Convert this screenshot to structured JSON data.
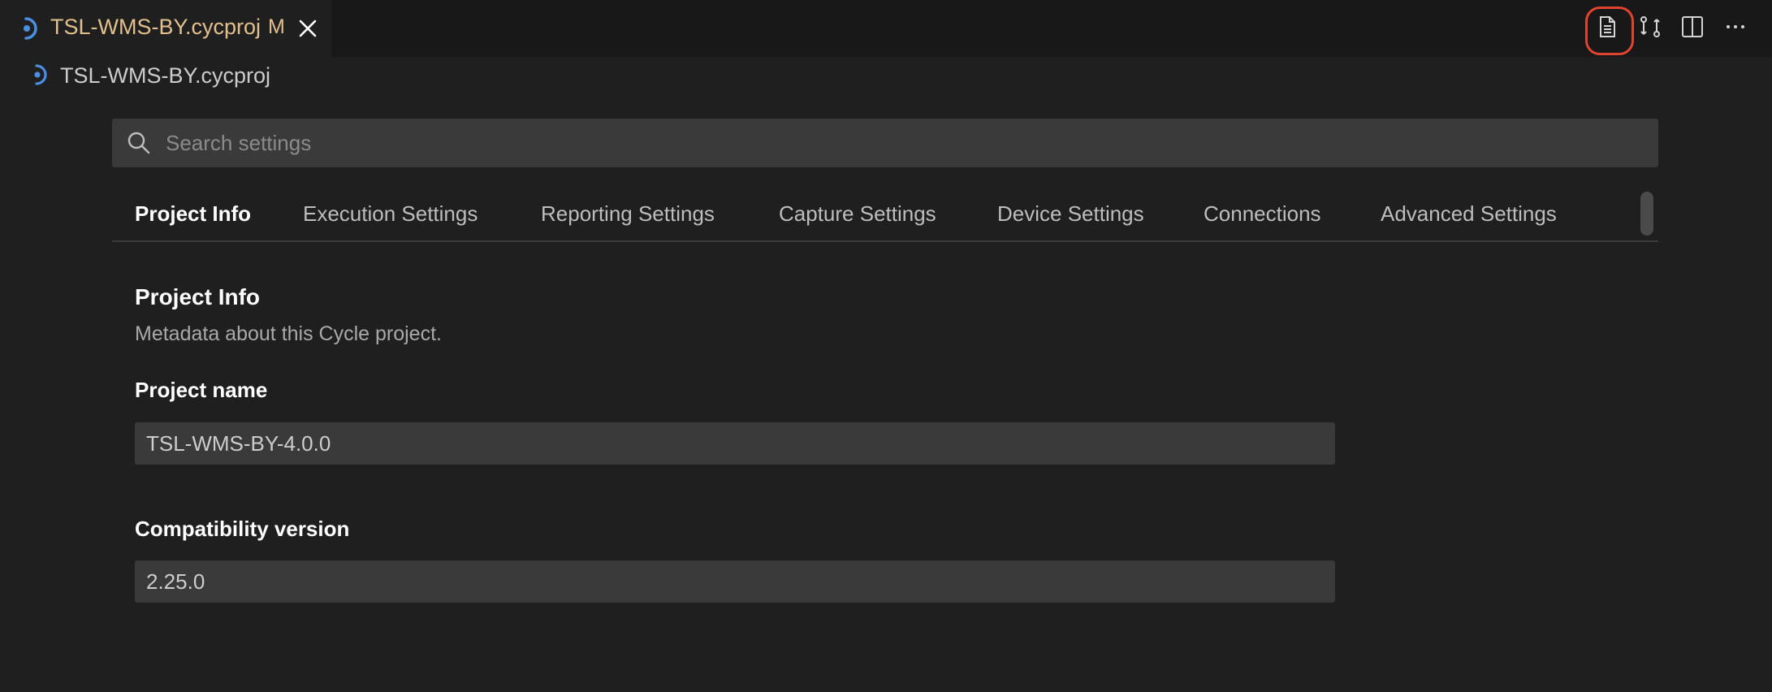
{
  "editor_tab": {
    "filename": "TSL-WMS-BY.cycproj",
    "modified_badge": "M",
    "accent_color": "#e2c08d",
    "icon": "cycle-file-icon"
  },
  "editor_actions": {
    "items": [
      {
        "name": "open-source-icon",
        "highlighted": true,
        "highlight_color": "#e0442f"
      },
      {
        "name": "compare-changes-icon"
      },
      {
        "name": "split-editor-icon"
      },
      {
        "name": "more-actions-icon"
      }
    ]
  },
  "breadcrumb": {
    "label": "TSL-WMS-BY.cycproj"
  },
  "search": {
    "placeholder": "Search settings",
    "value": ""
  },
  "settings_tabs": [
    {
      "label": "Project Info",
      "active": true
    },
    {
      "label": "Execution Settings",
      "active": false
    },
    {
      "label": "Reporting Settings",
      "active": false
    },
    {
      "label": "Capture Settings",
      "active": false
    },
    {
      "label": "Device Settings",
      "active": false
    },
    {
      "label": "Connections",
      "active": false
    },
    {
      "label": "Advanced Settings",
      "active": false
    }
  ],
  "section": {
    "title": "Project Info",
    "description": "Metadata about this Cycle project."
  },
  "fields": {
    "project_name": {
      "label": "Project name",
      "value": "TSL-WMS-BY-4.0.0"
    },
    "compatibility_version": {
      "label": "Compatibility version",
      "value": "2.25.0"
    }
  }
}
